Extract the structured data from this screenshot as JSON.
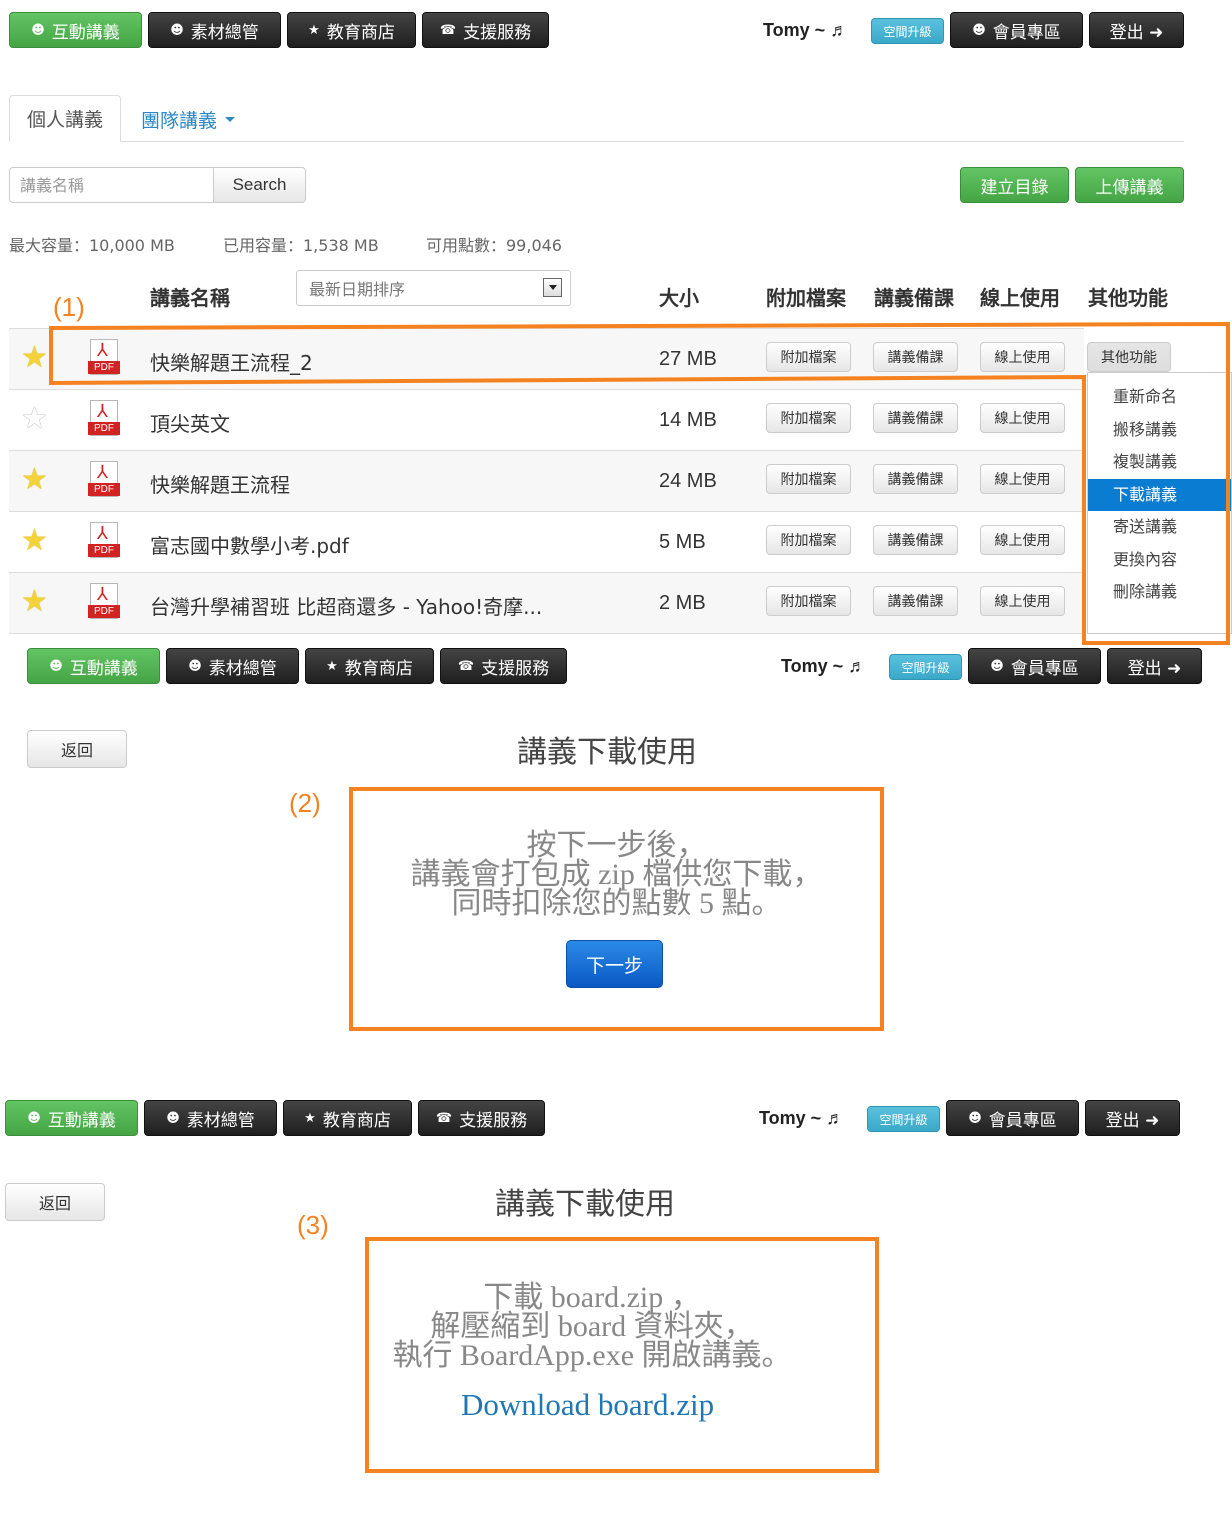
{
  "nav": {
    "interactive": "互動講義",
    "materials": "素材總管",
    "store": "教育商店",
    "support": "支援服務",
    "user": "Tomy ~ ♬",
    "upgrade": "空間升級",
    "member": "會員專區",
    "logout": "登出 ➜"
  },
  "icons": {
    "interactive": "smiley-icon",
    "materials": "smiley-icon",
    "store": "star-icon",
    "support": "phone-icon"
  },
  "tabs": {
    "personal": "個人講義",
    "team": "團隊講義"
  },
  "search": {
    "placeholder": "講義名稱",
    "button": "Search"
  },
  "actions": {
    "create_folder": "建立目錄",
    "upload": "上傳講義"
  },
  "stats": {
    "max": "最大容量：10,000 MB",
    "used": "已用容量：1,538 MB",
    "points": "可用點數：99,046"
  },
  "table": {
    "headers": {
      "name": "講義名稱",
      "size": "大小",
      "attach": "附加檔案",
      "prep": "講義備課",
      "online": "線上使用",
      "other": "其他功能"
    },
    "sort": "最新日期排序",
    "btn_attach": "附加檔案",
    "btn_prep": "講義備課",
    "btn_online": "線上使用",
    "btn_other": "其他功能",
    "pdf_label": "PDF",
    "rows": [
      {
        "name": "快樂解題王流程_2",
        "size": "27 MB",
        "starred": true
      },
      {
        "name": "頂尖英文",
        "size": "14 MB",
        "starred": false
      },
      {
        "name": "快樂解題王流程",
        "size": "24 MB",
        "starred": true
      },
      {
        "name": "富志國中數學小考.pdf",
        "size": "5 MB",
        "starred": true
      },
      {
        "name": "台灣升學補習班 比超商還多 - Yahoo!奇摩...",
        "size": "2 MB",
        "starred": true
      }
    ]
  },
  "menu": [
    "重新命名",
    "搬移講義",
    "複製講義",
    "下載講義",
    "寄送講義",
    "更換內容",
    "刪除講義"
  ],
  "menu_selected": "下載講義",
  "steps": [
    "(1)",
    "(2)",
    "(3)"
  ],
  "download": {
    "back": "返回",
    "title": "講義下載使用",
    "msg2": [
      "按下一步後，",
      "講義會打包成 zip 檔供您下載，",
      "同時扣除您的點數 5 點。"
    ],
    "next": "下一步",
    "msg3": [
      "下載 board.zip ，",
      "解壓縮到 board 資料夾，",
      "執行 BoardApp.exe 開啟講義。"
    ],
    "link": "Download board.zip"
  },
  "colors": {
    "highlight": "#f58220",
    "selected": "#0a7cd1",
    "green": "#51b351"
  }
}
